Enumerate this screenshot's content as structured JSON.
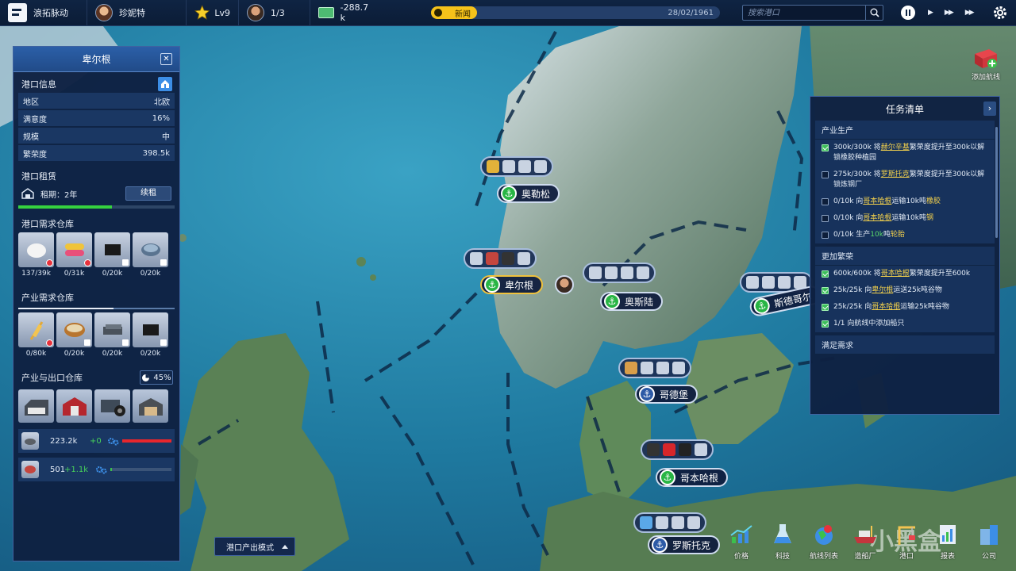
{
  "topbar": {
    "company": "浪拓脉动",
    "player": "珍妮特",
    "level": "Lv9",
    "crew": "1/3",
    "money": "-288.7 k",
    "news_label": "新闻",
    "date": "28/02/1961",
    "search_placeholder": "搜索港口"
  },
  "port_panel": {
    "title": "卑尔根",
    "info_section": "港口信息",
    "info": [
      {
        "key": "地区",
        "value": "北欧"
      },
      {
        "key": "满意度",
        "value": "16%"
      },
      {
        "key": "规模",
        "value": "中"
      },
      {
        "key": "繁荣度",
        "value": "398.5k"
      }
    ],
    "lease_section": "港口租赁",
    "lease_term": "租期：2年",
    "lease_button": "续租",
    "lease_progress": 0.6,
    "demand_section": "港口需求仓库",
    "demand": [
      {
        "icon": "cotton-icon",
        "amount": "137/39k",
        "warn": true
      },
      {
        "icon": "fabric-icon",
        "amount": "0/31k",
        "warn": true
      },
      {
        "icon": "chip-icon",
        "amount": "0/20k",
        "lock": true
      },
      {
        "icon": "can-icon",
        "amount": "0/20k",
        "lock": true
      }
    ],
    "industry_section": "产业需求仓库",
    "industry": [
      {
        "icon": "wheat-icon",
        "amount": "0/80k",
        "warn": true
      },
      {
        "icon": "grain-bowl-icon",
        "amount": "0/20k",
        "lock": true
      },
      {
        "icon": "steel-icon",
        "amount": "0/20k",
        "lock": true
      },
      {
        "icon": "chip-icon",
        "amount": "0/20k",
        "lock": true
      }
    ],
    "export_section": "产业与出口仓库",
    "export_percent": "45%",
    "factories": [
      "factory-icon",
      "barn-icon",
      "tire-factory-icon",
      "warehouse-icon"
    ],
    "production": [
      {
        "icon": "ore-icon",
        "amount": "223.2k",
        "gain": "+0",
        "fill": 1.0,
        "color": "#e8262c"
      },
      {
        "icon": "meat-icon",
        "amount": "501",
        "gain": "+1.1k",
        "fill": 0.02,
        "color": "#3cc04d"
      }
    ]
  },
  "task_panel": {
    "title": "任务清单",
    "groups": [
      {
        "title": "产业生产",
        "tasks": [
          {
            "done": true,
            "parts": [
              [
                "300k/300k 将",
                ""
              ],
              [
                "赫尔辛基",
                "hl"
              ],
              [
                "繁荣度提升至300k以解锁橡胶种植园",
                ""
              ]
            ]
          },
          {
            "done": false,
            "parts": [
              [
                "275k/300k 将",
                ""
              ],
              [
                "罗斯托克",
                "hl"
              ],
              [
                "繁荣度提升至300k以解锁炼钢厂",
                ""
              ]
            ]
          },
          {
            "done": false,
            "parts": [
              [
                "0/10k 向",
                ""
              ],
              [
                "哥本哈根",
                "hl"
              ],
              [
                "运输10k吨",
                ""
              ],
              [
                "橡胶",
                "y"
              ]
            ]
          },
          {
            "done": false,
            "parts": [
              [
                "0/10k 向",
                ""
              ],
              [
                "哥本哈根",
                "hl"
              ],
              [
                "运输10k吨",
                ""
              ],
              [
                "钢",
                "y"
              ]
            ]
          },
          {
            "done": false,
            "parts": [
              [
                "0/10k 生产",
                ""
              ],
              [
                "10k",
                "g"
              ],
              [
                "吨",
                ""
              ],
              [
                "轮胎",
                "y"
              ]
            ]
          }
        ]
      },
      {
        "title": "更加繁荣",
        "tasks": [
          {
            "done": true,
            "parts": [
              [
                "600k/600k 将",
                ""
              ],
              [
                "哥本哈根",
                "hl"
              ],
              [
                "繁荣度提升至600k",
                ""
              ]
            ]
          },
          {
            "done": true,
            "parts": [
              [
                "25k/25k 向",
                ""
              ],
              [
                "卑尔根",
                "hl"
              ],
              [
                "运送25k吨谷物",
                ""
              ]
            ]
          },
          {
            "done": true,
            "parts": [
              [
                "25k/25k 向",
                ""
              ],
              [
                "哥本哈根",
                "hl"
              ],
              [
                "运输25k吨谷物",
                ""
              ]
            ]
          },
          {
            "done": true,
            "parts": [
              [
                "1/1 向航线中添加船只",
                ""
              ]
            ]
          }
        ]
      },
      {
        "title": "满足需求",
        "tasks": []
      }
    ]
  },
  "ports": [
    {
      "name": "奥勒松",
      "cargo": [
        "wheat-icon",
        "drum-icon",
        "crates-icon",
        "crane-icon"
      ]
    },
    {
      "name": "卑尔根",
      "cargo": [
        "ore-icon",
        "meat-icon",
        "film-icon",
        "crane-icon"
      ]
    },
    {
      "name": "奥斯陆",
      "cargo": [
        "ore-icon",
        "crane-icon",
        "crane-icon",
        "crane-icon"
      ]
    },
    {
      "name": "斯德哥尔",
      "cargo": [
        "ore-icon",
        "crane-icon",
        "crane-icon",
        "crane-icon"
      ]
    },
    {
      "name": "哥德堡",
      "cargo": [
        "box-icon",
        "crane-icon",
        "crane-icon",
        "crane-icon"
      ]
    },
    {
      "name": "哥本哈根",
      "cargo": [
        "car-icon",
        "canister-icon",
        "tire-icon",
        "crane-icon"
      ]
    },
    {
      "name": "罗斯托克",
      "cargo": [
        "diamond-icon",
        "crane-icon",
        "crane-icon",
        "crane-icon"
      ]
    }
  ],
  "bottom": {
    "mode_label": "港口产出模式",
    "dock": [
      {
        "icon": "price-chart-icon",
        "label": "价格"
      },
      {
        "icon": "flask-icon",
        "label": "科技"
      },
      {
        "icon": "globe-pin-icon",
        "label": "航线列表"
      },
      {
        "icon": "shipyard-icon",
        "label": "造船厂"
      },
      {
        "icon": "port-crane-icon",
        "label": "港口"
      },
      {
        "icon": "report-icon",
        "label": "报表"
      },
      {
        "icon": "company-icon",
        "label": "公司"
      }
    ],
    "add_route": "添加航线",
    "watermark": "小黑盒"
  }
}
